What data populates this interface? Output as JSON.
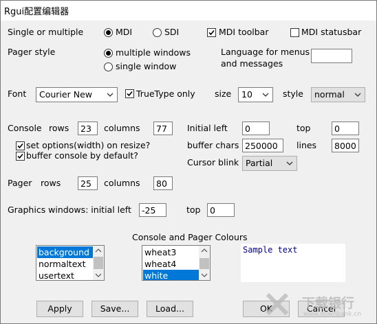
{
  "window": {
    "title": "Rgui配置编辑器"
  },
  "mdi": {
    "label": "Single or multiple",
    "options": [
      {
        "label": "MDI",
        "selected": true
      },
      {
        "label": "SDI",
        "selected": false
      }
    ],
    "toolbar": {
      "label": "MDI toolbar",
      "checked": true
    },
    "statusbar": {
      "label": "MDI statusbar",
      "checked": false
    }
  },
  "pager_style": {
    "label": "Pager style",
    "options": [
      {
        "label": "multiple windows",
        "selected": true
      },
      {
        "label": "single window",
        "selected": false
      }
    ]
  },
  "language": {
    "label_line1": "Language for menus",
    "label_line2": "and messages",
    "value": ""
  },
  "font": {
    "label": "Font",
    "value": "Courier New",
    "truetype": {
      "label": "TrueType only",
      "checked": true
    },
    "size_label": "size",
    "size_value": "10",
    "style_label": "style",
    "style_value": "normal"
  },
  "console": {
    "label": "Console",
    "rows_label": "rows",
    "rows": "23",
    "columns_label": "columns",
    "columns": "77",
    "set_options": {
      "label": "set options(width) on resize?",
      "checked": true
    },
    "buffer_console": {
      "label": "buffer console by default?",
      "checked": true
    },
    "initial_left_label": "Initial left",
    "initial_left": "0",
    "top_label": "top",
    "top": "0",
    "buffer_chars_label": "buffer chars",
    "buffer_chars": "250000",
    "lines_label": "lines",
    "lines": "8000",
    "cursor_blink_label": "Cursor blink",
    "cursor_blink": "Partial"
  },
  "pager": {
    "label": "Pager",
    "rows_label": "rows",
    "rows": "25",
    "columns_label": "columns",
    "columns": "80"
  },
  "graphics": {
    "label": "Graphics windows: initial left",
    "left": "-25",
    "top_label": "top",
    "top": "0"
  },
  "colours": {
    "heading": "Console and Pager Colours",
    "elements": [
      "background",
      "normaltext",
      "usertext"
    ],
    "element_selected": 0,
    "colors": [
      "wheat3",
      "wheat4",
      "white"
    ],
    "color_selected": 2,
    "sample_text": "Sample text",
    "selection_color": "#0078d7"
  },
  "buttons": {
    "apply": "Apply",
    "save": "Save...",
    "load": "Load...",
    "ok": "OK",
    "cancel": "Cancel"
  },
  "watermark": {
    "text": "下载银行",
    "url": "www.downbank.cn"
  }
}
